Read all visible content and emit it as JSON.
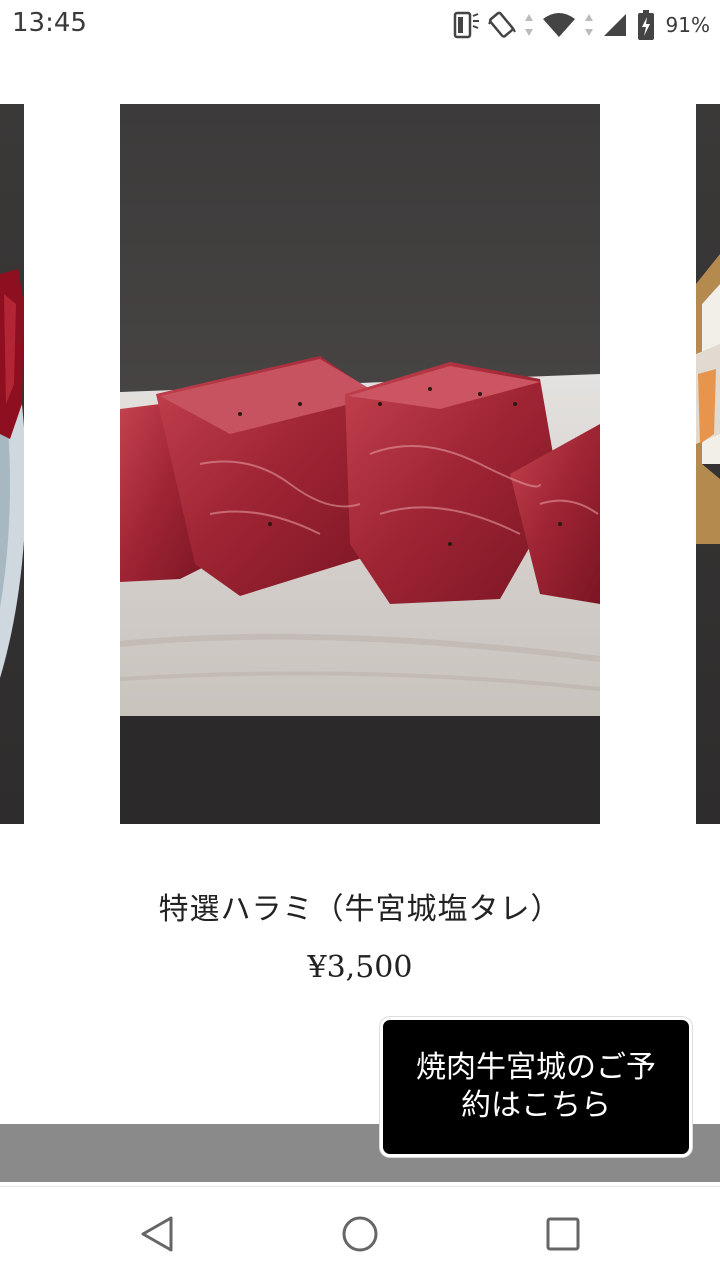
{
  "status_bar": {
    "time": "13:45",
    "battery_percent": "91%",
    "icons": [
      "screen-rotate-icon",
      "vibrate-icon",
      "wifi-icon",
      "cell-signal-icon",
      "battery-charging-icon"
    ]
  },
  "product": {
    "name": "特選ハラミ（牛宮城塩タレ）",
    "price": "¥3,500"
  },
  "reservation_button": {
    "label": "焼肉牛宮城のご予約はこちら"
  },
  "nav_bar": {
    "icons": [
      "back-icon",
      "home-icon",
      "recent-apps-icon"
    ]
  },
  "colors": {
    "button_bg": "#000000",
    "grey_bar": "#8a8a8a",
    "text": "#222222"
  }
}
